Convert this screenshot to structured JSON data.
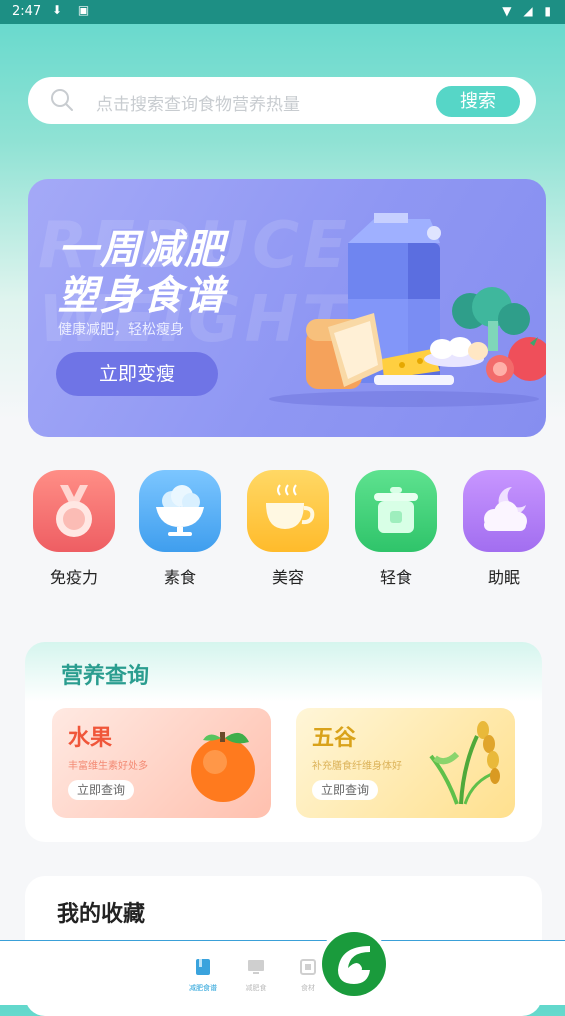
{
  "status_bar": {
    "time": "2:47",
    "left_icons": "⬇ ▣",
    "right_icons": "▼ ◢ ▮"
  },
  "search": {
    "placeholder": "点击搜索查询食物营养热量",
    "button_label": "搜索"
  },
  "banner": {
    "watermark": "REDUCE WEIGHT",
    "title_line1": "一周减肥",
    "title_line2": "塑身食谱",
    "subtitle": "健康减肥，轻松瘦身",
    "button_label": "立即变瘦"
  },
  "categories": [
    {
      "label": "免疫力",
      "icon": "medal-icon",
      "color": "#f3726f"
    },
    {
      "label": "素食",
      "icon": "salad-bowl-icon",
      "color": "#56aef2"
    },
    {
      "label": "美容",
      "icon": "coffee-cup-icon",
      "color": "#ffc93c"
    },
    {
      "label": "轻食",
      "icon": "cooking-pot-icon",
      "color": "#3ccf76"
    },
    {
      "label": "助眠",
      "icon": "moon-cloud-icon",
      "color": "#b27cf2"
    }
  ],
  "nutrition": {
    "title": "营养查询",
    "cards": [
      {
        "name": "水果",
        "desc": "丰富维生素好处多",
        "button_label": "立即查询",
        "icon": "orange-fruit-icon"
      },
      {
        "name": "五谷",
        "desc": "补充膳食纤维身体好",
        "button_label": "立即查询",
        "icon": "wheat-grain-icon"
      }
    ]
  },
  "favorites": {
    "title": "我的收藏"
  },
  "bottom_nav": {
    "tabs": [
      {
        "label": "减肥食谱",
        "icon": "book-icon",
        "active": true
      },
      {
        "label": "减肥食",
        "icon": "monitor-icon",
        "active": false
      },
      {
        "label": "食材",
        "icon": "grid-box-icon",
        "active": false
      }
    ],
    "logo": "leaf-logo-icon"
  }
}
